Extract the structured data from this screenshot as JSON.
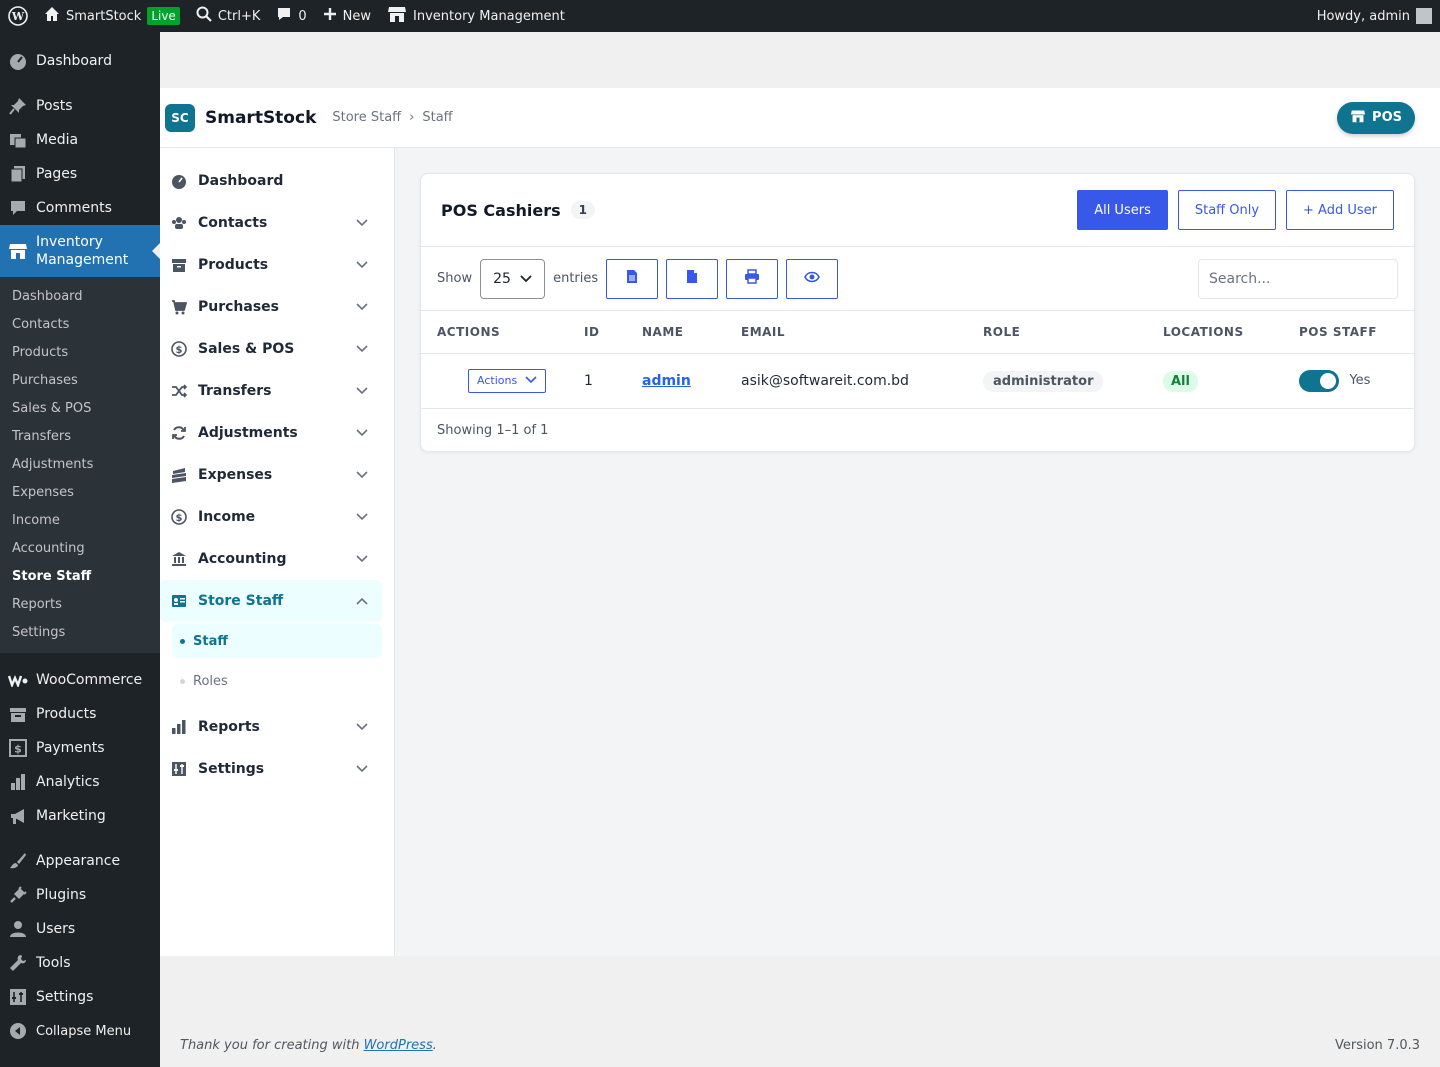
{
  "adminbar": {
    "site_name": "SmartStock",
    "live_badge": "Live",
    "search_shortcut": "Ctrl+K",
    "comments_count": "0",
    "new_label": "New",
    "inventory_label": "Inventory Management",
    "howdy": "Howdy, admin"
  },
  "wpmenu": {
    "dashboard": "Dashboard",
    "posts": "Posts",
    "media": "Media",
    "pages": "Pages",
    "comments": "Comments",
    "inventory": "Inventory Management",
    "submenu": [
      "Dashboard",
      "Contacts",
      "Products",
      "Purchases",
      "Sales & POS",
      "Transfers",
      "Adjustments",
      "Expenses",
      "Income",
      "Accounting",
      "Store Staff",
      "Reports",
      "Settings"
    ],
    "woocommerce": "WooCommerce",
    "products": "Products",
    "payments": "Payments",
    "analytics": "Analytics",
    "marketing": "Marketing",
    "appearance": "Appearance",
    "plugins": "Plugins",
    "users": "Users",
    "tools": "Tools",
    "settings": "Settings",
    "collapse": "Collapse Menu"
  },
  "app": {
    "logo": "SC",
    "title": "SmartStock",
    "crumb1": "Store Staff",
    "crumb_sep": "›",
    "crumb2": "Staff",
    "pos_label": "POS"
  },
  "appside": {
    "items": [
      "Dashboard",
      "Contacts",
      "Products",
      "Purchases",
      "Sales & POS",
      "Transfers",
      "Adjustments",
      "Expenses",
      "Income",
      "Accounting"
    ],
    "store_staff": "Store Staff",
    "staff": "Staff",
    "roles": "Roles",
    "reports": "Reports",
    "settings": "Settings"
  },
  "card": {
    "title": "POS Cashiers",
    "count": "1",
    "all_users": "All Users",
    "staff_only": "Staff Only",
    "add_user": "+ Add User",
    "show": "Show",
    "entries_value": "25",
    "entries": "entries",
    "search_placeholder": "Search...",
    "columns": [
      "ACTIONS",
      "ID",
      "NAME",
      "EMAIL",
      "ROLE",
      "LOCATIONS",
      "POS STAFF"
    ],
    "row": {
      "actions": "Actions",
      "id": "1",
      "name": "admin",
      "email": "asik@softwareit.com.bd",
      "role": "administrator",
      "locations": "All",
      "pos_staff": "Yes"
    },
    "showing": "Showing 1–1 of 1"
  },
  "footer": {
    "thanks_prefix": "Thank you for creating with ",
    "wp_link": "WordPress",
    "thanks_suffix": ".",
    "version": "Version 7.0.3"
  }
}
